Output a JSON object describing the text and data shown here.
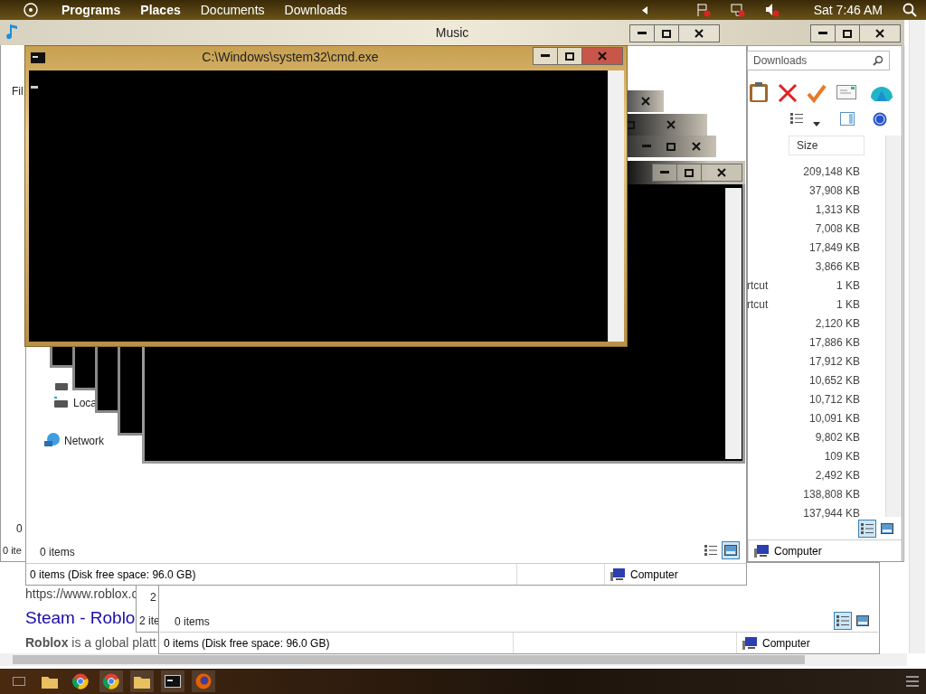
{
  "top_panel": {
    "menus": [
      {
        "label": "Programs",
        "bold": true
      },
      {
        "label": "Places",
        "bold": true
      },
      {
        "label": "Documents",
        "bold": false
      },
      {
        "label": "Downloads",
        "bold": false
      }
    ],
    "clock": "Sat 7:46 AM"
  },
  "browser": {
    "url": "https://www.roblox.c",
    "link": "Steam - Roblo",
    "snippet": "**Roblox** is a global platt"
  },
  "music_window": {
    "title": "Music",
    "texts": [
      "Fil",
      "0",
      "0 ite"
    ]
  },
  "downloads_window": {
    "search": {
      "value": "Downloads"
    },
    "column": "Size",
    "rows": [
      {
        "size": "209,148 KB"
      },
      {
        "size": "37,908 KB"
      },
      {
        "size": "1,313 KB"
      },
      {
        "size": "7,008 KB"
      },
      {
        "size": "17,849 KB"
      },
      {
        "size": "3,866 KB"
      },
      {
        "name": "rtcut",
        "size": "1 KB"
      },
      {
        "name": "rtcut",
        "size": "1 KB"
      },
      {
        "size": "2,120 KB"
      },
      {
        "size": "17,886 KB"
      },
      {
        "size": "17,912 KB"
      },
      {
        "size": "10,652 KB"
      },
      {
        "size": "10,712 KB"
      },
      {
        "size": "10,091 KB"
      },
      {
        "size": "9,802 KB"
      },
      {
        "size": "109 KB"
      },
      {
        "size": "2,492 KB"
      },
      {
        "size": "138,808 KB"
      },
      {
        "size": "137,944 KB"
      }
    ],
    "views": [
      {
        "selected": true
      },
      {
        "selected": false
      }
    ],
    "location": "Computer"
  },
  "explorer_front": {
    "nav": [
      "Loca",
      "Network"
    ],
    "items": "0 items",
    "views": [
      {
        "selected": false
      },
      {
        "selected": true
      }
    ],
    "status": "0 items (Disk free space: 96.0 GB)",
    "location": "Computer"
  },
  "explorer_back": {
    "side_texts": [
      "2",
      "2 ite"
    ],
    "items": "0 items",
    "views": [
      {
        "selected": true
      },
      {
        "selected": false
      }
    ],
    "status": "0 items (Disk free space: 96.0 GB)",
    "location": "Computer"
  },
  "cmd_window": {
    "title": "C:\\Windows\\system32\\cmd.exe"
  }
}
